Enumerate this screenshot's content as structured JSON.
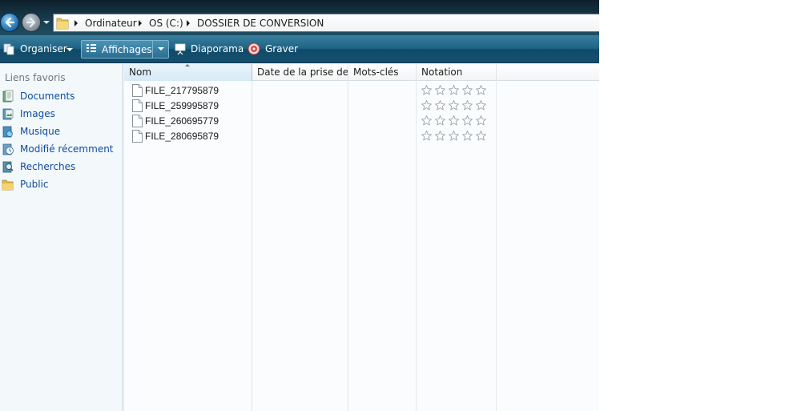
{
  "window": {
    "accent_color": "#1f6385"
  },
  "address_bar": {
    "breadcrumbs": [
      "Ordinateur",
      "OS (C:)",
      "DOSSIER DE CONVERSION"
    ]
  },
  "toolbar": {
    "organiser_label": "Organiser",
    "affichages_label": "Affichages",
    "diaporama_label": "Diaporama",
    "graver_label": "Graver"
  },
  "navigation": {
    "header": "Liens favoris",
    "items": [
      {
        "label": "Documents",
        "icon": "documents-icon"
      },
      {
        "label": "Images",
        "icon": "images-icon"
      },
      {
        "label": "Musique",
        "icon": "music-icon"
      },
      {
        "label": "Modifié récemment",
        "icon": "recent-icon"
      },
      {
        "label": "Recherches",
        "icon": "searches-icon"
      },
      {
        "label": "Public",
        "icon": "folder-icon"
      }
    ]
  },
  "file_list": {
    "columns": [
      "Nom",
      "Date de la prise de ...",
      "Mots-clés",
      "Notation"
    ],
    "sorted_column": "Nom",
    "files": [
      {
        "name": "FILE_217795879",
        "rating": 0
      },
      {
        "name": "FILE_259995879",
        "rating": 0
      },
      {
        "name": "FILE_260695779",
        "rating": 0
      },
      {
        "name": "FILE_280695879",
        "rating": 0
      }
    ],
    "max_rating": 5
  }
}
